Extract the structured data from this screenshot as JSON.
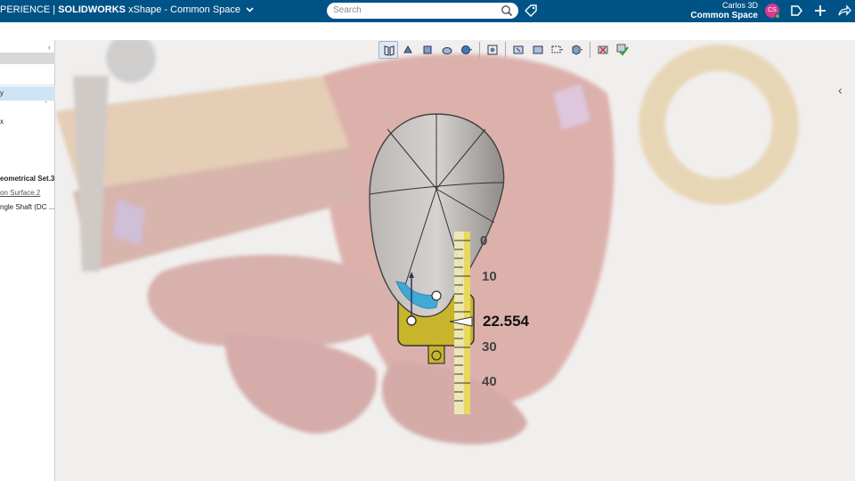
{
  "header": {
    "brand_prefix": "PERIENCE |",
    "brand_app": "SOLIDWORKS",
    "brand_rest": "xShape - Common Space",
    "search_placeholder": "Search",
    "user_name": "Carlos 3D",
    "user_space": "Common Space",
    "avatar_initials": "CS"
  },
  "left_panel": {
    "row1": "y",
    "row2": "x",
    "geometrical_set": "eometrical Set.3",
    "surface_link": "on Surface.2",
    "shaft": "ngle Shaft (DC ..."
  },
  "viewport": {
    "measure_value": "22.554",
    "ruler_labels": [
      "0",
      "10",
      "30",
      "40"
    ]
  },
  "colors": {
    "topbar": "#005386",
    "selection": "#2aa3d8",
    "ruler_fill": "#e6d44a",
    "bracket_fill": "#c9b52c"
  }
}
